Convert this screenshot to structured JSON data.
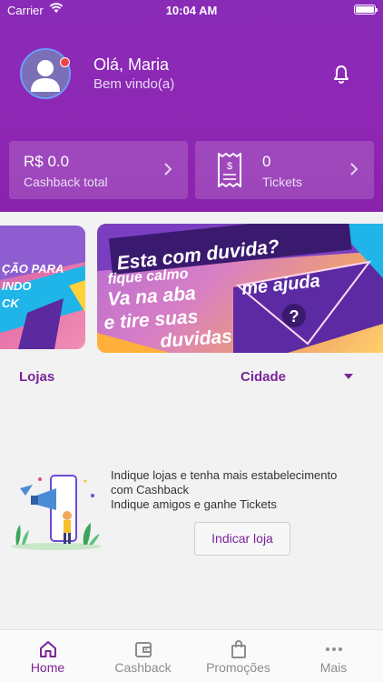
{
  "status_bar": {
    "carrier": "Carrier",
    "time": "10:04 AM"
  },
  "header": {
    "greeting": "Olá, Maria",
    "welcome": "Bem vindo(a)",
    "icons": {
      "avatar": "user-avatar",
      "notification": "bell-icon",
      "badge_color": "#f04545"
    }
  },
  "cards": {
    "cashback": {
      "value": "R$ 0.0",
      "label": "Cashback total"
    },
    "tickets": {
      "value": "0",
      "label": "Tickets"
    }
  },
  "banners": {
    "left": {
      "line1": "ÇÃO PARA",
      "line2": "INDO",
      "line3": "CK"
    },
    "right": {
      "headline": "Esta com duvida?",
      "line1": "fique calmo",
      "line2": "Va na aba",
      "line3": "me ajuda",
      "line4": "e tire suas",
      "line5": "duvidas",
      "question_mark": "?"
    }
  },
  "filters": {
    "lojas": "Lojas",
    "cidade": "Cidade"
  },
  "empty_state": {
    "line1": "Indique lojas e tenha mais estabelecimento",
    "line2": "com Cashback",
    "line3": "Indique amigos e ganhe Tickets",
    "button": "Indicar loja"
  },
  "bottom_nav": {
    "items": [
      {
        "label": "Home",
        "icon": "home-icon",
        "active": true
      },
      {
        "label": "Cashback",
        "icon": "wallet-icon",
        "active": false
      },
      {
        "label": "Promoções",
        "icon": "shopping-bag-icon",
        "active": false
      },
      {
        "label": "Mais",
        "icon": "more-icon",
        "active": false
      }
    ]
  },
  "colors": {
    "primary": "#8a2bb8",
    "accent": "#7a2497",
    "inactive": "#8c8c8c",
    "background": "#f2f2f2"
  }
}
